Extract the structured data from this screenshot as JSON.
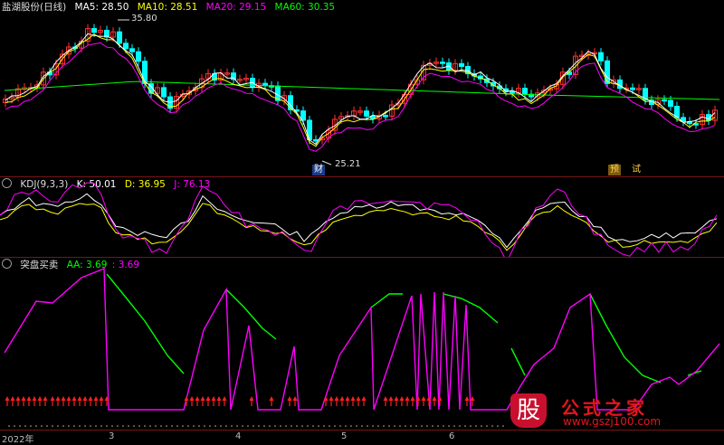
{
  "main_panel": {
    "title": "盐湖股份(日线)",
    "ma5_label": "MA5: 28.50",
    "ma10_label": "MA10: 28.51",
    "ma20_label": "MA20: 29.15",
    "ma60_label": "MA60: 30.35",
    "high_label": "35.80",
    "low_label": "25.21",
    "badge_cai": "财",
    "badge_yu": "预",
    "badge_shi": "试",
    "colors": {
      "ma5": "#ffffff",
      "ma10": "#ffff00",
      "ma20": "#ff00ff",
      "ma60": "#00ff00",
      "up": "#ff3232",
      "down": "#00ffff"
    }
  },
  "kdj_panel": {
    "title": "KDJ(9,3,3)",
    "k_label": "K: 50.01",
    "d_label": "D: 36.95",
    "j_label": "J: 76.13"
  },
  "signal_panel": {
    "title": "突盘买卖",
    "aa_label": "AA: 3.69",
    "aa2_label": ": 3.69"
  },
  "time_axis": {
    "labels": [
      "2022年",
      "3",
      "4",
      "5",
      "6"
    ]
  },
  "watermark": {
    "logo_char": "股",
    "name": "公式之家",
    "url": "www.gszj100.com"
  }
}
